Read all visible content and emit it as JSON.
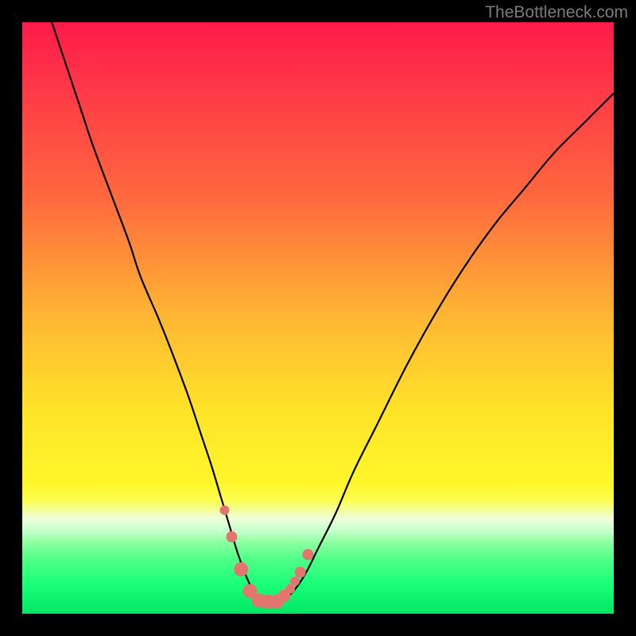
{
  "watermark": "TheBottleneck.com",
  "colors": {
    "bg": "#000000",
    "curve": "#000000",
    "marker_fill": "#e2756e",
    "marker_stroke": "#d65a55",
    "gradient_stops": [
      {
        "offset": "0%",
        "color": "#ff1a4b"
      },
      {
        "offset": "12%",
        "color": "#ff3a47"
      },
      {
        "offset": "30%",
        "color": "#ff6a3e"
      },
      {
        "offset": "50%",
        "color": "#ffb733"
      },
      {
        "offset": "66%",
        "color": "#ffe428"
      },
      {
        "offset": "78%",
        "color": "#fff62a"
      },
      {
        "offset": "81%",
        "color": "#fbff54"
      },
      {
        "offset": "83%",
        "color": "#f3ffb0"
      },
      {
        "offset": "84%",
        "color": "#edffdb"
      },
      {
        "offset": "86%",
        "color": "#c6ffcb"
      },
      {
        "offset": "88%",
        "color": "#8cff9f"
      },
      {
        "offset": "91%",
        "color": "#4cff86"
      },
      {
        "offset": "95%",
        "color": "#1bff78"
      },
      {
        "offset": "100%",
        "color": "#00e765"
      }
    ]
  },
  "chart_data": {
    "type": "line",
    "title": "",
    "xlabel": "",
    "ylabel": "",
    "xlim": [
      0,
      100
    ],
    "ylim": [
      0,
      100
    ],
    "series": [
      {
        "name": "bottleneck-curve",
        "x": [
          5,
          8,
          10,
          12,
          15,
          18,
          20,
          23,
          25,
          28,
          30,
          32,
          33.5,
          35,
          36.5,
          38,
          39,
          40,
          41,
          42,
          44,
          46,
          48,
          50,
          53,
          56,
          60,
          65,
          70,
          75,
          80,
          85,
          90,
          95,
          100
        ],
        "y": [
          100,
          91,
          85,
          79,
          71,
          63,
          57,
          50,
          45,
          37,
          31,
          25,
          20,
          15,
          10,
          6,
          4,
          2.2,
          2,
          2,
          2.2,
          4,
          7,
          11,
          17,
          24,
          32,
          42,
          51,
          59,
          66,
          72,
          78,
          83,
          88
        ]
      }
    ],
    "markers": {
      "name": "highlight-points",
      "x": [
        34.2,
        35.4,
        37.0,
        38.5,
        40.0,
        41.5,
        43.0,
        44.3,
        45.3,
        46.1,
        47.0,
        48.3
      ],
      "y": [
        17.5,
        13.0,
        7.5,
        3.8,
        2.2,
        2.0,
        2.0,
        3.0,
        4.2,
        5.5,
        7.0,
        10.0
      ],
      "r": [
        6,
        7,
        9,
        9,
        9,
        9,
        9,
        8,
        6,
        6,
        7,
        7
      ]
    }
  }
}
